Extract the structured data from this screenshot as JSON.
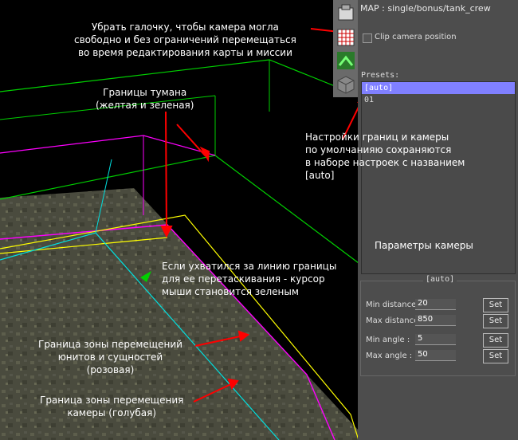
{
  "editor": {
    "map_title": "MAP : single/bonus/tank_crew",
    "clip_camera_label": "Clip camera position",
    "clip_camera_checked": false,
    "presets_label": "Presets:",
    "presets": [
      "[auto]",
      "01"
    ],
    "selected_preset": "[auto]",
    "camera_group_title": "[auto]",
    "camera_params": [
      {
        "label": "Min distance :",
        "value": "20",
        "button": "Set"
      },
      {
        "label": "Max distance :",
        "value": "850",
        "button": "Set"
      },
      {
        "label": "Min angle :",
        "value": "5",
        "button": "Set"
      },
      {
        "label": "Max angle :",
        "value": "50",
        "button": "Set"
      }
    ],
    "toolbar_icons": [
      "camera-icon",
      "grid-icon",
      "terrain-icon",
      "cube-icon"
    ]
  },
  "annotations": {
    "uncheck_clip": [
      "Убрать галочку, чтобы камера могла",
      "свободно и без ограничений перемещаться",
      "во время редактирования карты и миссии"
    ],
    "fog_borders": [
      "Границы тумана",
      "(желтая и зеленая)"
    ],
    "presets_note": [
      "Настройки границ и камеры",
      "по умолчанияю сохраняются",
      "в наборе настроек с названием",
      "[auto]"
    ],
    "camera_params_note": "Параметры камеры",
    "cursor_note": [
      "Если ухватился за линию границы",
      "для ее перетаскивания - курсор",
      "мыши становится зеленым"
    ],
    "units_border": [
      "Граница зоны перемещений",
      "юнитов и сущностей",
      "(розовая)"
    ],
    "camera_border": [
      "Граница зоны перемещения",
      "камеры (голубая)"
    ]
  },
  "colors": {
    "fog_yellow": "#ffff00",
    "fog_green": "#00d000",
    "units_pink": "#ff00ff",
    "camera_cyan": "#00e0e0",
    "arrow_red": "#ff0000",
    "panel_bg": "#4d4d4d",
    "preset_highlight": "#8080ff"
  }
}
